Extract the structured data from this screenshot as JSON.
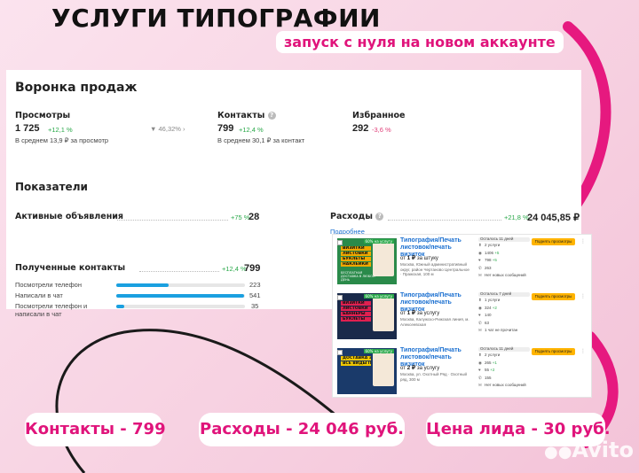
{
  "header": {
    "title": "УСЛУГИ ТИПОГРАФИИ",
    "subtitle": "запуск с нуля на новом аккаунте"
  },
  "funnel": {
    "title": "Воронка продаж",
    "views": {
      "label": "Просмотры",
      "value": "1 725",
      "delta": "+12,1 %",
      "avg": "В среднем 13,9 ₽ за просмотр",
      "conversion": "46,32%"
    },
    "contacts": {
      "label": "Контакты",
      "value": "799",
      "delta": "+12,4 %",
      "avg": "В среднем 30,1 ₽ за контакт"
    },
    "favorites": {
      "label": "Избранное",
      "value": "292",
      "delta": "-3,6 %"
    }
  },
  "metrics": {
    "title": "Показатели",
    "active_ads": {
      "label": "Активные объявления",
      "delta": "+75 %",
      "value": "28"
    },
    "expenses": {
      "label": "Расходы",
      "delta": "+21,8 %",
      "value": "24 045,85 ₽",
      "link": "Подробнее"
    },
    "received_contacts": {
      "label": "Полученные контакты",
      "delta": "+12,4 %",
      "value": "799",
      "rows": [
        {
          "label": "Посмотрели телефон",
          "value": "223",
          "share": 0.41
        },
        {
          "label": "Написали в чат",
          "value": "541",
          "share": 0.99
        },
        {
          "label": "Посмотрели телефон и написали в чат",
          "value": "35",
          "share": 0.06
        }
      ]
    }
  },
  "ads": [
    {
      "title": "Типография/Печать листовок/печать визиток",
      "price_prefix": "от",
      "price": "1 ₽",
      "price_unit": "за штуку",
      "address": "Москва, Южный административный округ, район Чертаново Центральное · Пражская, 100 м",
      "days": "Осталось 11 дней",
      "stats": [
        "2 услуги",
        "1406",
        "798",
        "263",
        "Нет новых сообщений"
      ],
      "stat_deltas": [
        "",
        "+5",
        "+5",
        "",
        ""
      ],
      "button": "Поднять просмотры",
      "badge": "60% на услугу",
      "img_lines": [
        "ВИЗИТКИ",
        "ЛИСТОВКИ",
        "БУКЛЕТЫ",
        "НАКЛЕЙКИ"
      ],
      "img_footer": "БЕСПЛАТНАЯ ДОСТАВКА В ЛЮБОЙ ДЕНЬ",
      "colors": {
        "bg": "#2a8a4a",
        "accent": "#f0a800"
      }
    },
    {
      "title": "Типография/Печать листовок/печать визиток",
      "price_prefix": "от",
      "price": "1 ₽",
      "price_unit": "за услугу",
      "address": "Москва, Калужско-Рижская линия, м. Алексеевская",
      "days": "Осталось 7 дней",
      "stats": [
        "1 услуги",
        "324",
        "140",
        "63",
        "1 чат не прочитан"
      ],
      "stat_deltas": [
        "",
        "+2",
        "",
        "",
        ""
      ],
      "button": "Поднять просмотры",
      "badge": "60% на услугу",
      "img_lines": [
        "ВИЗИТКИ",
        "ЛИСТОВКИ",
        "БАННЕРЫ",
        "БУКЛЕТЫ"
      ],
      "img_footer": "",
      "colors": {
        "bg": "#1a2a4a",
        "accent": "#e02050"
      }
    },
    {
      "title": "Типография/Печать листовок/печать визиток",
      "price_prefix": "от",
      "price": "2 ₽",
      "price_unit": "за услугу",
      "address": "Москва, ул. Охотный Ряд · Охотный ряд, 300 м",
      "days": "Осталось 11 дней",
      "stats": [
        "2 услуги",
        "265",
        "55",
        "155",
        "Нет новых сообщений"
      ],
      "stat_deltas": [
        "",
        "+1",
        "+2",
        "",
        ""
      ],
      "button": "Поднять просмотры",
      "badge": "60% на услугу",
      "img_lines": [
        "ДОСТАВКА ЗА 24 ЧАСА",
        "ВСЕ ВИДЫ ПЕЧАТИ"
      ],
      "img_footer": "",
      "colors": {
        "bg": "#1a3a6a",
        "accent": "#f0c800"
      }
    }
  ],
  "summary": {
    "contacts": "Контакты - 799",
    "expenses": "Расходы - 24 046 руб.",
    "lead_price": "Цена лида - 30 руб."
  },
  "watermark": "Avito",
  "colors": {
    "brand": "#e0147b",
    "bar": "#1aa0e0",
    "button": "#ffb400",
    "link": "#1a6fd0",
    "positive": "#2aa84a",
    "negative": "#e0407a"
  }
}
